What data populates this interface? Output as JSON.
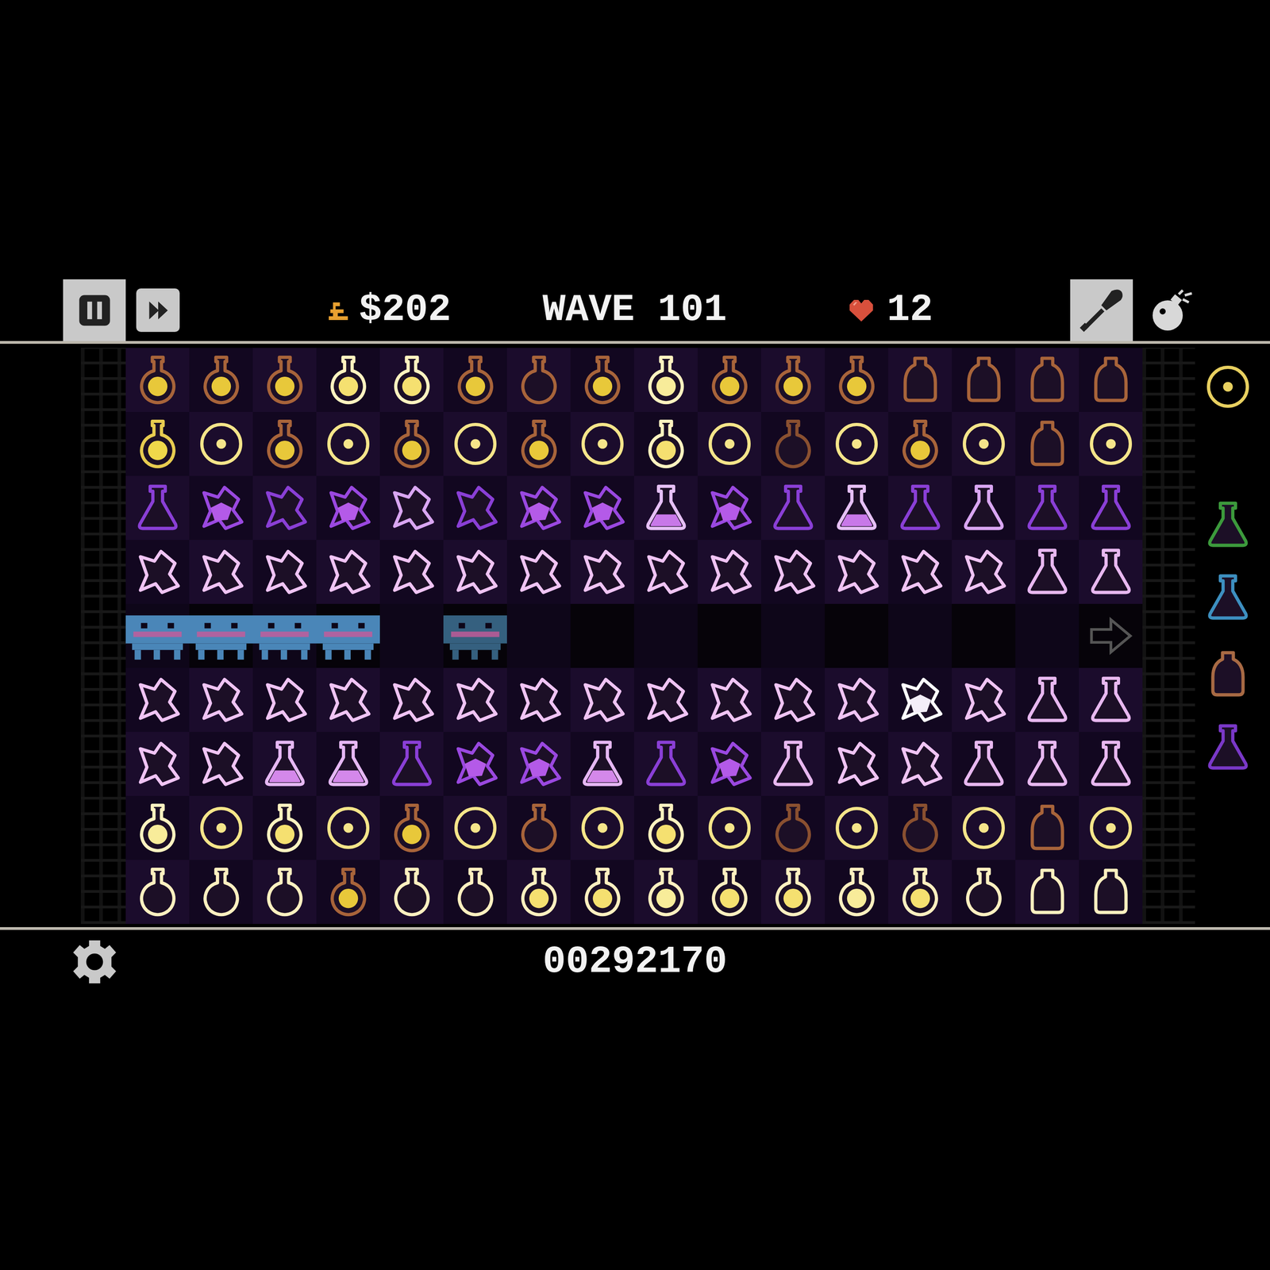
{
  "hud": {
    "money": "$202",
    "wave": "WAVE 101",
    "lives": "12",
    "score": "00292170"
  },
  "tools": [
    {
      "selected": true
    },
    {
      "selected": false
    }
  ],
  "board": {
    "rows": [
      {
        "path": false,
        "cells": [
          {
            "kind": "bulb",
            "color": "#a8643a",
            "liquid": "#e8c83a"
          },
          {
            "kind": "bulb",
            "color": "#a8643a",
            "liquid": "#e8c83a"
          },
          {
            "kind": "bulb",
            "color": "#a8643a",
            "liquid": "#e8c83a"
          },
          {
            "kind": "bulb",
            "color": "#fff3c0",
            "liquid": "#f5e070"
          },
          {
            "kind": "bulb",
            "color": "#fff3c0",
            "liquid": "#f5e070"
          },
          {
            "kind": "bulb",
            "color": "#a8643a",
            "liquid": "#e8c83a"
          },
          {
            "kind": "bulb",
            "color": "#a8643a"
          },
          {
            "kind": "bulb",
            "color": "#a8643a",
            "liquid": "#e8c83a"
          },
          {
            "kind": "bulb",
            "color": "#fff3c0",
            "liquid": "#f8ec9a"
          },
          {
            "kind": "bulb",
            "color": "#a8643a",
            "liquid": "#e8c83a"
          },
          {
            "kind": "bulb",
            "color": "#a8643a",
            "liquid": "#e8c83a"
          },
          {
            "kind": "bulb",
            "color": "#a8643a",
            "liquid": "#e8c83a"
          },
          {
            "kind": "jar",
            "color": "#a8643a"
          },
          {
            "kind": "jar",
            "color": "#a8643a"
          },
          {
            "kind": "jar",
            "color": "#a8643a"
          },
          {
            "kind": "jar",
            "color": "#a8643a"
          }
        ]
      },
      {
        "path": false,
        "cells": [
          {
            "kind": "bulb",
            "color": "#e8cc50",
            "liquid": "#f0d84a"
          },
          {
            "kind": "ring",
            "color": "#f5e58a"
          },
          {
            "kind": "bulb",
            "color": "#a8643a",
            "liquid": "#e8c83a"
          },
          {
            "kind": "ring",
            "color": "#f5e58a"
          },
          {
            "kind": "bulb",
            "color": "#a8643a",
            "liquid": "#e8c83a"
          },
          {
            "kind": "ring",
            "color": "#f5e58a"
          },
          {
            "kind": "bulb",
            "color": "#a8643a",
            "liquid": "#e8c83a"
          },
          {
            "kind": "ring",
            "color": "#f5e58a"
          },
          {
            "kind": "bulb",
            "color": "#fff3c0",
            "liquid": "#f5e070"
          },
          {
            "kind": "ring",
            "color": "#f5e58a"
          },
          {
            "kind": "bulb",
            "color": "#8a5030"
          },
          {
            "kind": "ring",
            "color": "#f5e58a"
          },
          {
            "kind": "bulb",
            "color": "#a8643a",
            "liquid": "#e8c83a"
          },
          {
            "kind": "ring",
            "color": "#f5e58a"
          },
          {
            "kind": "jar",
            "color": "#a8643a"
          },
          {
            "kind": "ring",
            "color": "#f5e58a"
          }
        ]
      },
      {
        "path": false,
        "cells": [
          {
            "kind": "flask",
            "color": "#8a3fd6"
          },
          {
            "kind": "shard",
            "color": "#9a48e0",
            "liquid": "#b45ae8"
          },
          {
            "kind": "shard",
            "color": "#8a3fd6"
          },
          {
            "kind": "shard",
            "color": "#9a48e0",
            "liquid": "#b45ae8"
          },
          {
            "kind": "shard",
            "color": "#d9a6f2"
          },
          {
            "kind": "shard",
            "color": "#8a3fd6"
          },
          {
            "kind": "shard",
            "color": "#9a48e0",
            "liquid": "#b45ae8"
          },
          {
            "kind": "shard",
            "color": "#9a48e0",
            "liquid": "#b45ae8"
          },
          {
            "kind": "flask",
            "color": "#e6c0f6",
            "liquid": "#c878e8"
          },
          {
            "kind": "shard",
            "color": "#9a48e0",
            "liquid": "#b45ae8"
          },
          {
            "kind": "flask",
            "color": "#8a3fd6"
          },
          {
            "kind": "flask",
            "color": "#e6c0f6",
            "liquid": "#c878e8"
          },
          {
            "kind": "flask",
            "color": "#8a3fd6"
          },
          {
            "kind": "flask",
            "color": "#d9a6f2"
          },
          {
            "kind": "flask",
            "color": "#8a3fd6"
          },
          {
            "kind": "flask",
            "color": "#8a3fd6"
          }
        ]
      },
      {
        "path": false,
        "cells": [
          {
            "kind": "shard",
            "color": "#f0c4f4"
          },
          {
            "kind": "shard",
            "color": "#f0c4f4"
          },
          {
            "kind": "shard",
            "color": "#f0c4f4"
          },
          {
            "kind": "shard",
            "color": "#f0c4f4"
          },
          {
            "kind": "shard",
            "color": "#f0c4f4"
          },
          {
            "kind": "shard",
            "color": "#f0c4f4"
          },
          {
            "kind": "shard",
            "color": "#f0c4f4"
          },
          {
            "kind": "shard",
            "color": "#f0c4f4"
          },
          {
            "kind": "shard",
            "color": "#f0c4f4"
          },
          {
            "kind": "shard",
            "color": "#f0c4f4"
          },
          {
            "kind": "shard",
            "color": "#f0c4f4"
          },
          {
            "kind": "shard",
            "color": "#f0c4f4"
          },
          {
            "kind": "shard",
            "color": "#f0c4f4"
          },
          {
            "kind": "shard",
            "color": "#f0c4f4"
          },
          {
            "kind": "flask",
            "color": "#e8b8f0"
          },
          {
            "kind": "flask",
            "color": "#e8b8f0"
          }
        ]
      },
      {
        "path": true,
        "cells": [
          {
            "kind": "enemy",
            "color": "#4a86b8"
          },
          {
            "kind": "enemy",
            "color": "#4a86b8"
          },
          {
            "kind": "enemy",
            "color": "#4a86b8"
          },
          {
            "kind": "enemy",
            "color": "#4a86b8"
          },
          {
            "kind": "empty"
          },
          {
            "kind": "enemy",
            "color": "#35607f"
          },
          {
            "kind": "empty"
          },
          {
            "kind": "empty"
          },
          {
            "kind": "empty"
          },
          {
            "kind": "empty"
          },
          {
            "kind": "empty"
          },
          {
            "kind": "empty"
          },
          {
            "kind": "empty"
          },
          {
            "kind": "empty"
          },
          {
            "kind": "empty"
          },
          {
            "kind": "arrow",
            "color": "#555555"
          }
        ]
      },
      {
        "path": false,
        "cells": [
          {
            "kind": "shard",
            "color": "#f0c4f4"
          },
          {
            "kind": "shard",
            "color": "#f0c4f4"
          },
          {
            "kind": "shard",
            "color": "#f0c4f4"
          },
          {
            "kind": "shard",
            "color": "#f0c4f4"
          },
          {
            "kind": "shard",
            "color": "#f0c4f4"
          },
          {
            "kind": "shard",
            "color": "#f0c4f4"
          },
          {
            "kind": "shard",
            "color": "#f0c4f4"
          },
          {
            "kind": "shard",
            "color": "#f0c4f4"
          },
          {
            "kind": "shard",
            "color": "#f0c4f4"
          },
          {
            "kind": "shard",
            "color": "#f0c4f4"
          },
          {
            "kind": "shard",
            "color": "#f0c4f4"
          },
          {
            "kind": "shard",
            "color": "#f0c4f4"
          },
          {
            "kind": "shard",
            "color": "#ffffff",
            "liquid": "#f4eef8"
          },
          {
            "kind": "shard",
            "color": "#f0c4f4"
          },
          {
            "kind": "flask",
            "color": "#e8b8f0"
          },
          {
            "kind": "flask",
            "color": "#e8b8f0"
          }
        ]
      },
      {
        "path": false,
        "cells": [
          {
            "kind": "shard",
            "color": "#f0c4f4"
          },
          {
            "kind": "shard",
            "color": "#f0c4f4"
          },
          {
            "kind": "flask",
            "color": "#e6b8f4",
            "liquid": "#d488ea"
          },
          {
            "kind": "flask",
            "color": "#e6b8f4",
            "liquid": "#d488ea"
          },
          {
            "kind": "flask",
            "color": "#8a3fd6"
          },
          {
            "kind": "shard",
            "color": "#9a48e0",
            "liquid": "#b45ae8"
          },
          {
            "kind": "shard",
            "color": "#9a48e0",
            "liquid": "#b45ae8"
          },
          {
            "kind": "flask",
            "color": "#e6b8f4",
            "liquid": "#d488ea"
          },
          {
            "kind": "flask",
            "color": "#8a3fd6"
          },
          {
            "kind": "shard",
            "color": "#9a48e0",
            "liquid": "#b45ae8"
          },
          {
            "kind": "flask",
            "color": "#e8b8f0"
          },
          {
            "kind": "shard",
            "color": "#f0c4f4"
          },
          {
            "kind": "shard",
            "color": "#f0c4f4"
          },
          {
            "kind": "flask",
            "color": "#e8b8f0"
          },
          {
            "kind": "flask",
            "color": "#e8b8f0"
          },
          {
            "kind": "flask",
            "color": "#e8b8f0"
          }
        ]
      },
      {
        "path": false,
        "cells": [
          {
            "kind": "bulb",
            "color": "#fff3c0",
            "liquid": "#f8ec9a"
          },
          {
            "kind": "ring",
            "color": "#f5e58a"
          },
          {
            "kind": "bulb",
            "color": "#fff3c0",
            "liquid": "#f5e070"
          },
          {
            "kind": "ring",
            "color": "#f5e58a"
          },
          {
            "kind": "bulb",
            "color": "#a8643a",
            "liquid": "#e8c83a"
          },
          {
            "kind": "ring",
            "color": "#f5e58a"
          },
          {
            "kind": "bulb",
            "color": "#a8643a"
          },
          {
            "kind": "ring",
            "color": "#f5e58a"
          },
          {
            "kind": "bulb",
            "color": "#fff3c0",
            "liquid": "#f5e070"
          },
          {
            "kind": "ring",
            "color": "#f5e58a"
          },
          {
            "kind": "bulb",
            "color": "#8a5030"
          },
          {
            "kind": "ring",
            "color": "#f5e58a"
          },
          {
            "kind": "bulb",
            "color": "#8a5030"
          },
          {
            "kind": "ring",
            "color": "#f5e58a"
          },
          {
            "kind": "jar",
            "color": "#a8643a"
          },
          {
            "kind": "ring",
            "color": "#f5e58a"
          }
        ]
      },
      {
        "path": false,
        "cells": [
          {
            "kind": "bulb",
            "color": "#fff0c0"
          },
          {
            "kind": "bulb",
            "color": "#fff0c0"
          },
          {
            "kind": "bulb",
            "color": "#fff0c0"
          },
          {
            "kind": "bulb",
            "color": "#a8643a",
            "liquid": "#e8c83a"
          },
          {
            "kind": "bulb",
            "color": "#fff0c0"
          },
          {
            "kind": "bulb",
            "color": "#fff0c0"
          },
          {
            "kind": "bulb",
            "color": "#fff0c0",
            "liquid": "#f5e070"
          },
          {
            "kind": "bulb",
            "color": "#fff0c0",
            "liquid": "#f5e070"
          },
          {
            "kind": "bulb",
            "color": "#fff0c0",
            "liquid": "#f8ec9a"
          },
          {
            "kind": "bulb",
            "color": "#fff0c0",
            "liquid": "#f5e070"
          },
          {
            "kind": "bulb",
            "color": "#fff0c0",
            "liquid": "#f5e070"
          },
          {
            "kind": "bulb",
            "color": "#fff0c0",
            "liquid": "#f8ec9a"
          },
          {
            "kind": "bulb",
            "color": "#fff0c0",
            "liquid": "#f5e070"
          },
          {
            "kind": "bulb",
            "color": "#fff0c0"
          },
          {
            "kind": "jar",
            "color": "#fff0c0"
          },
          {
            "kind": "jar",
            "color": "#fff0c0"
          }
        ]
      }
    ]
  },
  "palette": [
    {
      "kind": "ring",
      "color": "#e8d060",
      "selected": false
    },
    {
      "kind": "flask",
      "color": "#3c9a3c",
      "selected": false
    },
    {
      "kind": "flask",
      "color": "#3d8fc0",
      "selected": false
    },
    {
      "kind": "jar",
      "color": "#a86a44",
      "selected": false
    },
    {
      "kind": "flask",
      "color": "#7a38c8",
      "selected": false
    }
  ]
}
